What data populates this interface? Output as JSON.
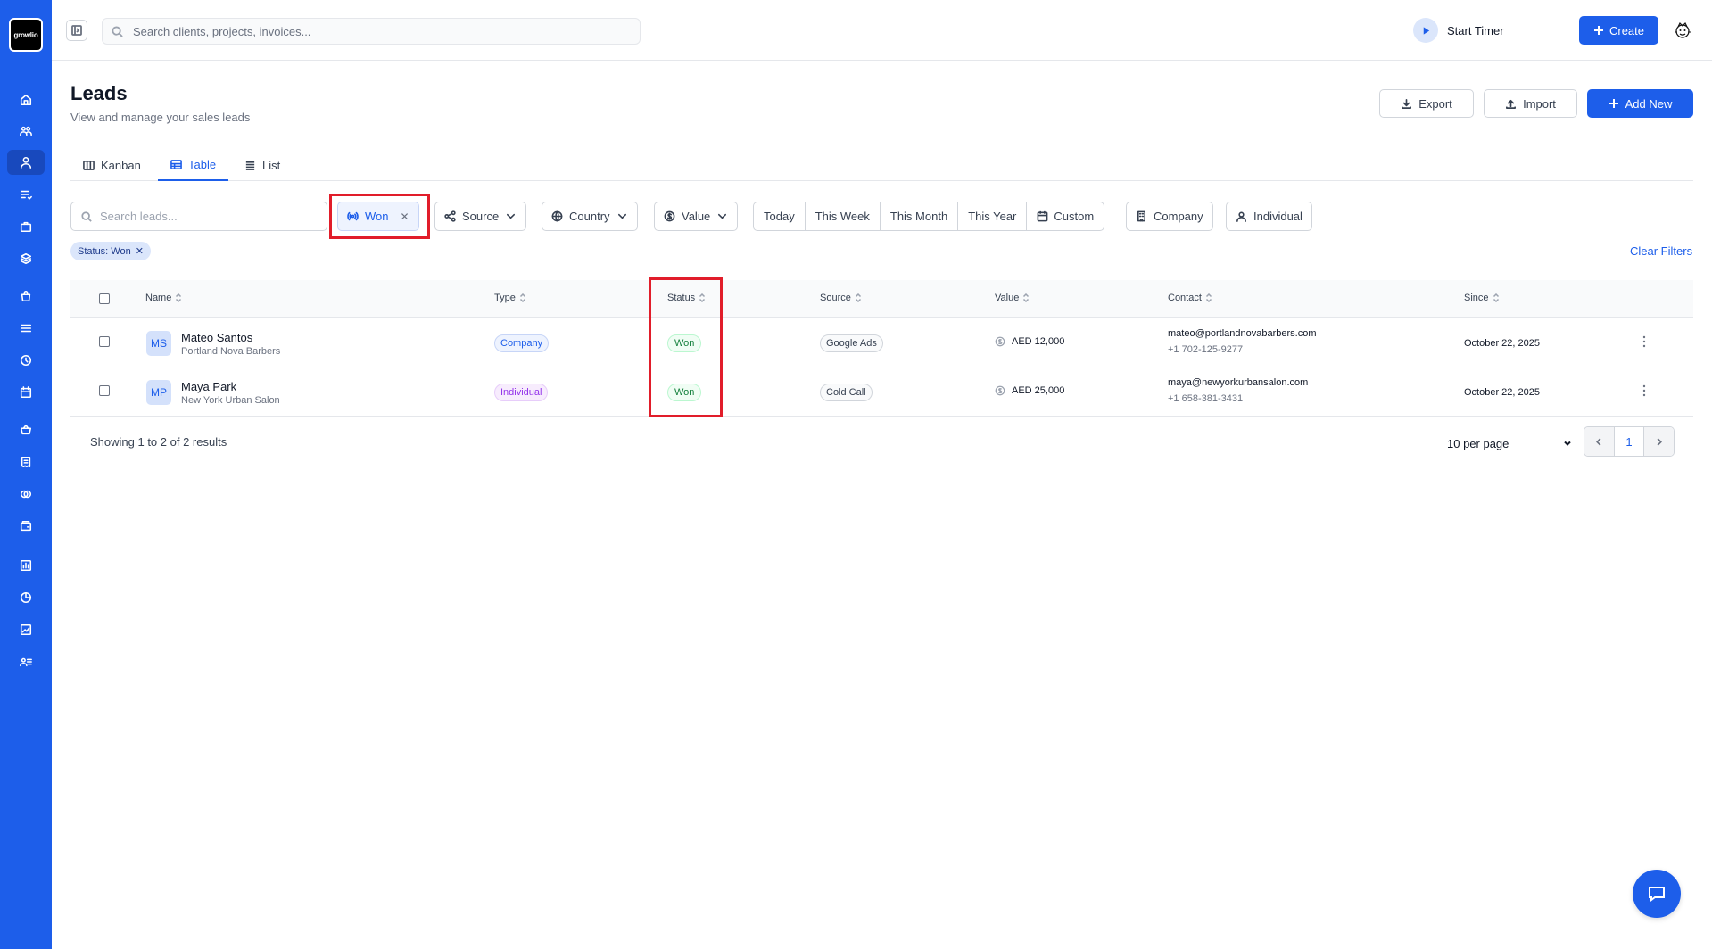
{
  "app": {
    "logo_text": "growlio"
  },
  "topbar": {
    "search_placeholder": "Search clients, projects, invoices...",
    "start_timer_label": "Start Timer",
    "create_label": "Create"
  },
  "page": {
    "title": "Leads",
    "subtitle": "View and manage your sales leads",
    "export_label": "Export",
    "import_label": "Import",
    "add_new_label": "Add New"
  },
  "tabs": [
    {
      "label": "Kanban",
      "icon": "columns-icon"
    },
    {
      "label": "Table",
      "icon": "table-icon",
      "active": true
    },
    {
      "label": "List",
      "icon": "list-icon"
    }
  ],
  "filters": {
    "search_placeholder": "Search leads...",
    "status_chip": "Won",
    "source": "Source",
    "country": "Country",
    "value": "Value",
    "dates": [
      "Today",
      "This Week",
      "This Month",
      "This Year",
      "Custom"
    ],
    "company": "Company",
    "individual": "Individual",
    "active_tag": "Status: Won",
    "clear": "Clear Filters"
  },
  "table": {
    "columns": [
      "Name",
      "Type",
      "Status",
      "Source",
      "Value",
      "Contact",
      "Since"
    ],
    "rows": [
      {
        "initials": "MS",
        "name": "Mateo Santos",
        "company": "Portland Nova Barbers",
        "type": "Company",
        "status": "Won",
        "source": "Google Ads",
        "value": "AED 12,000",
        "email": "mateo@portlandnovabarbers.com",
        "phone": "+1 702-125-9277",
        "since": "October 22, 2025"
      },
      {
        "initials": "MP",
        "name": "Maya Park",
        "company": "New York Urban Salon",
        "type": "Individual",
        "status": "Won",
        "source": "Cold Call",
        "value": "AED 25,000",
        "email": "maya@newyorkurbansalon.com",
        "phone": "+1 658-381-3431",
        "since": "October 22, 2025"
      }
    ]
  },
  "footer": {
    "showing": "Showing 1 to 2 of 2 results",
    "per_page": "10 per page",
    "current_page": "1"
  },
  "colors": {
    "primary": "#1d5eea",
    "highlight": "#e11d2a",
    "won": "#15803d"
  }
}
